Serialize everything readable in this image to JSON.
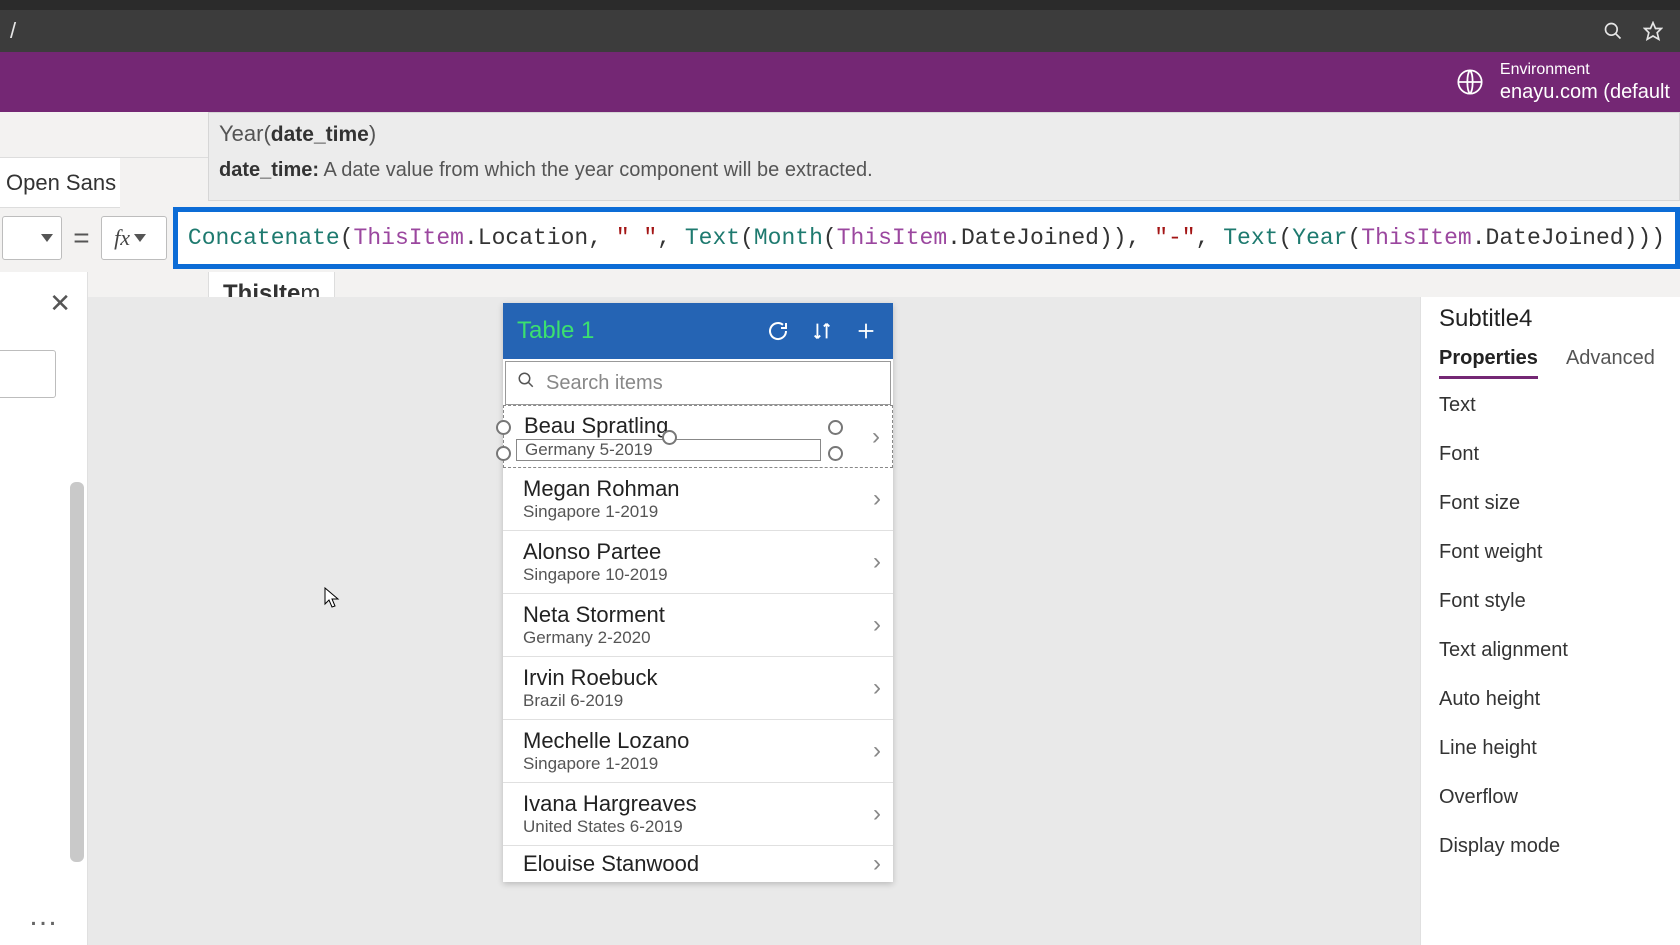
{
  "browser": {
    "addr_hint": "/"
  },
  "environment": {
    "label": "Environment",
    "name": "enayu.com (default"
  },
  "hint": {
    "signature_prefix": "Year(",
    "signature_bold": "date_time",
    "signature_suffix": ")",
    "param_name": "date_time:",
    "param_desc": "A date value from which the year component will be extracted."
  },
  "toolbar": {
    "font_name": "Open Sans",
    "eq": "=",
    "fx": "fx"
  },
  "formula": {
    "fn_concat": "Concatenate",
    "open": "(",
    "kw_this": "ThisItem",
    "dot": ".",
    "loc": "Location",
    "comma_sp": ", ",
    "str_space": "\" \"",
    "fn_text": "Text",
    "fn_month": "Month",
    "datejoined": "DateJoined",
    "close": ")",
    "str_dash": "\"-\"",
    "fn_year": "Year"
  },
  "intellisense": "ThisItem",
  "gallery": {
    "title": "Table 1",
    "search_placeholder": "Search items",
    "items": [
      {
        "name": "Beau Spratling",
        "sub": "Germany 5-2019"
      },
      {
        "name": "Megan Rohman",
        "sub": "Singapore 1-2019"
      },
      {
        "name": "Alonso Partee",
        "sub": "Singapore 10-2019"
      },
      {
        "name": "Neta Storment",
        "sub": "Germany 2-2020"
      },
      {
        "name": "Irvin Roebuck",
        "sub": "Brazil 6-2019"
      },
      {
        "name": "Mechelle Lozano",
        "sub": "Singapore 1-2019"
      },
      {
        "name": "Ivana Hargreaves",
        "sub": "United States 6-2019"
      },
      {
        "name": "Elouise Stanwood",
        "sub": ""
      }
    ]
  },
  "props": {
    "ctrl_name": "Subtitle4",
    "tab_props": "Properties",
    "tab_adv": "Advanced",
    "rows": [
      "Text",
      "Font",
      "Font size",
      "Font weight",
      "Font style",
      "Text alignment",
      "Auto height",
      "Line height",
      "Overflow",
      "Display mode"
    ]
  },
  "tree": {
    "more": "…"
  }
}
